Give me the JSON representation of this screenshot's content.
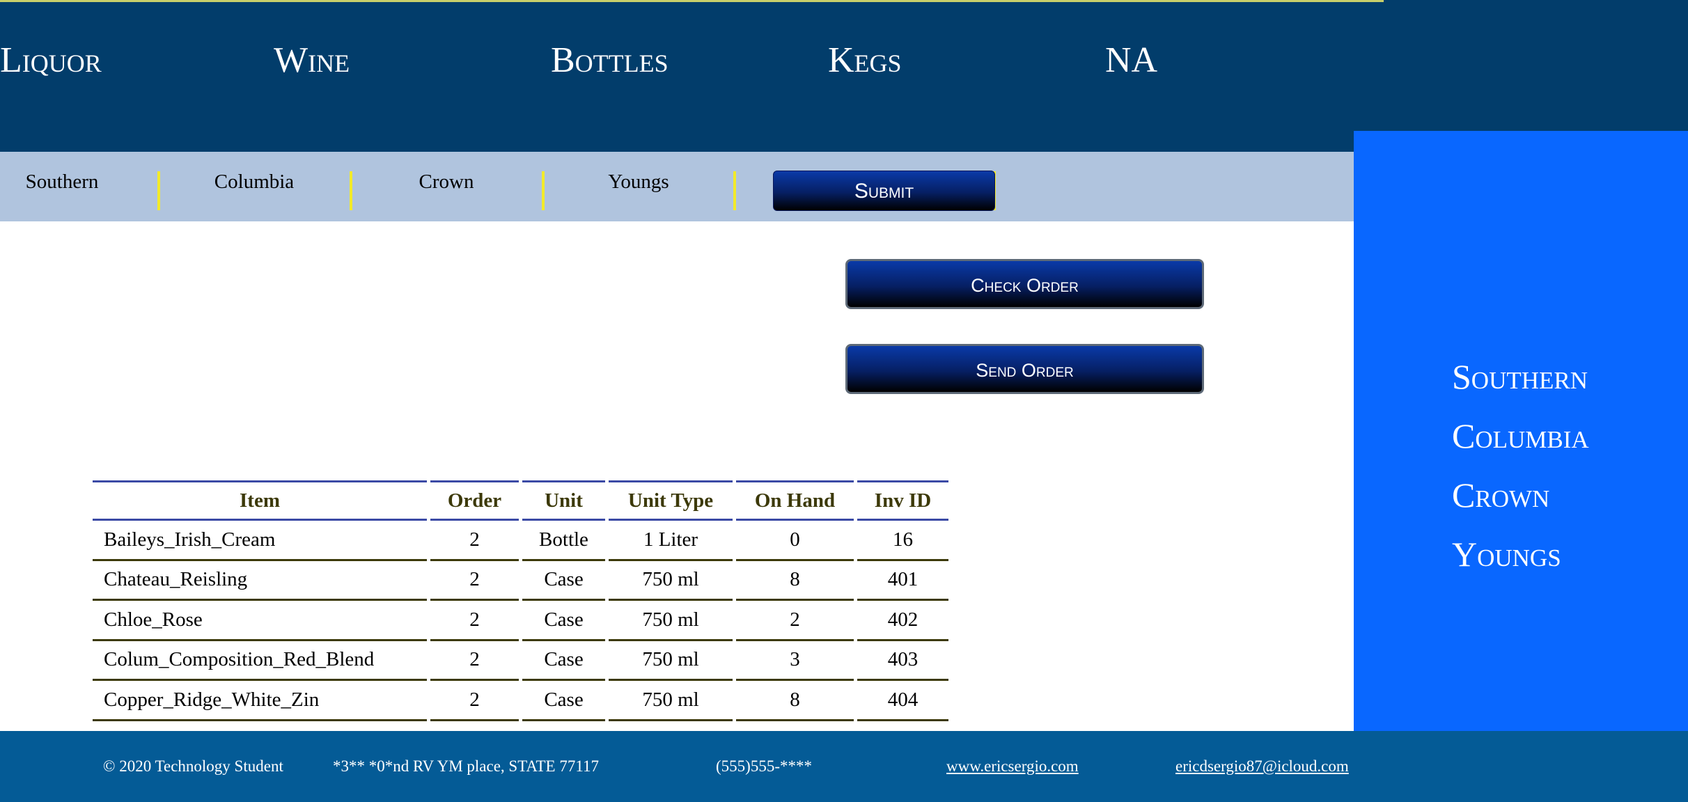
{
  "header": {
    "categories": [
      "Liquor",
      "Wine",
      "Bottles",
      "Kegs",
      "NA"
    ]
  },
  "sub_nav": {
    "items": [
      "Southern",
      "Columbia",
      "Crown",
      "Youngs"
    ],
    "submit_label": "Submit"
  },
  "actions": {
    "check_order_label": "Check Order",
    "send_order_label": "Send Order"
  },
  "side_panel": {
    "distributors": [
      "Southern",
      "Columbia",
      "Crown",
      "Youngs"
    ]
  },
  "table": {
    "columns": [
      "Item",
      "Order",
      "Unit",
      "Unit Type",
      "On Hand",
      "Inv ID"
    ],
    "rows": [
      [
        "Baileys_Irish_Cream",
        "2",
        "Bottle",
        "1 Liter",
        "0",
        "16"
      ],
      [
        "Chateau_Reisling",
        "2",
        "Case",
        "750 ml",
        "8",
        "401"
      ],
      [
        "Chloe_Rose",
        "2",
        "Case",
        "750 ml",
        "2",
        "402"
      ],
      [
        "Colum_Composition_Red_Blend",
        "2",
        "Case",
        "750 ml",
        "3",
        "403"
      ],
      [
        "Copper_Ridge_White_Zin",
        "2",
        "Case",
        "750 ml",
        "8",
        "404"
      ]
    ]
  },
  "footer": {
    "copyright": "© 2020 Technology Student",
    "address": "*3** *0*nd RV YM place, STATE 77117",
    "phone": "(555)555-****",
    "website": "www.ericsergio.com",
    "email": "ericdsergio87@icloud.com"
  },
  "colors": {
    "header_bg": "#023d6b",
    "sub_nav_bg": "#b0c4de",
    "separator": "#f2ea2a",
    "side_panel_bg": "#0967ff",
    "footer_bg": "#045b96",
    "table_header_text": "#3c3909"
  }
}
